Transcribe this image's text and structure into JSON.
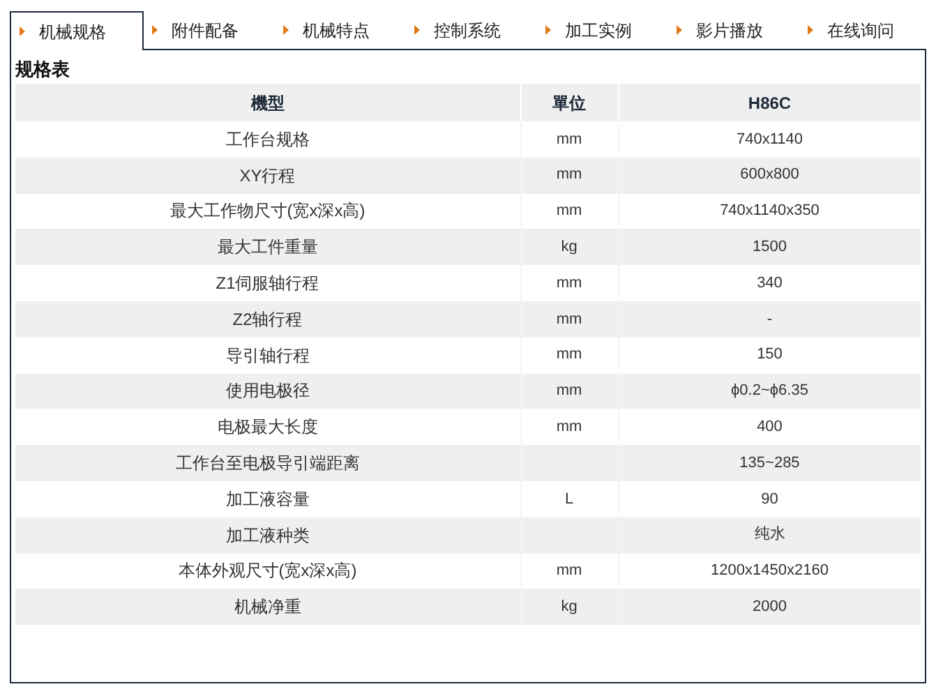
{
  "tabs": [
    {
      "label": "机械规格",
      "selected": true
    },
    {
      "label": "附件配备",
      "selected": false
    },
    {
      "label": "机械特点",
      "selected": false
    },
    {
      "label": "控制系统",
      "selected": false
    },
    {
      "label": "加工实例",
      "selected": false
    },
    {
      "label": "影片播放",
      "selected": false
    },
    {
      "label": "在线询问",
      "selected": false
    }
  ],
  "section_title": "规格表",
  "table": {
    "columns": [
      "機型",
      "單位",
      "H86C"
    ],
    "rows": [
      [
        "工作台规格",
        "mm",
        "740x1140"
      ],
      [
        "XY行程",
        "mm",
        "600x800"
      ],
      [
        "最大工作物尺寸(宽x深x高)",
        "mm",
        "740x1140x350"
      ],
      [
        "最大工件重量",
        "kg",
        "1500"
      ],
      [
        "Z1伺服轴行程",
        "mm",
        "340"
      ],
      [
        "Z2轴行程",
        "mm",
        "-"
      ],
      [
        "导引轴行程",
        "mm",
        "150"
      ],
      [
        "使用电极径",
        "mm",
        "ϕ0.2~ϕ6.35"
      ],
      [
        "电极最大长度",
        "mm",
        "400"
      ],
      [
        "工作台至电极导引端距离",
        "",
        "135~285"
      ],
      [
        "加工液容量",
        "L",
        "90"
      ],
      [
        "加工液种类",
        "",
        "纯水"
      ],
      [
        "本体外观尺寸(宽x深x高)",
        "mm",
        "1200x1450x2160"
      ],
      [
        "机械净重",
        "kg",
        "2000"
      ]
    ]
  }
}
